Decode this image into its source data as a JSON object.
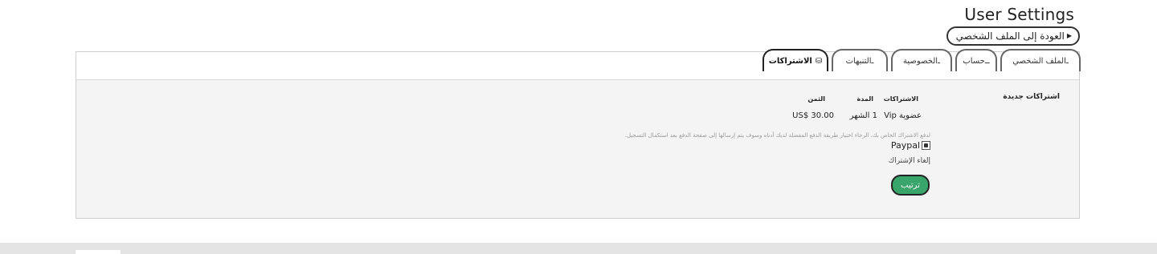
{
  "header": {
    "title": "User Settings",
    "back_label": "العودة إلى الملف الشخصي"
  },
  "tabs": [
    {
      "label": "الملف الشخصي",
      "prefix": "ـ"
    },
    {
      "label": "حساب",
      "prefix": "ــ"
    },
    {
      "label": "الخصوصية",
      "prefix": "ـ"
    },
    {
      "label": "التنبهات",
      "prefix": "ـ"
    },
    {
      "label": "الاشتراكات",
      "icon": "coins-icon",
      "active": true
    }
  ],
  "subscriptions": {
    "section_title": "اشتراكات جديدة",
    "columns": [
      "الاشتراكات",
      "المدة",
      "الثمن"
    ],
    "row": {
      "name": "عضوية Vip",
      "duration": "1 الشهر",
      "price": "US$ 30.00"
    },
    "payment_note": "لدفع الاشتراك الخاص بك، الرجاء اختيار طريقة الدفع المفضلة لديك أدناه وسوف يتم إرسالها إلى صفحة الدفع بعد استكمال التسجيل.",
    "payment_option": "Paypal",
    "payment_selected": true,
    "cancel_label": "إلغاء الإشتراك",
    "order_button": "ترتيب"
  },
  "colors": {
    "accent_button": "#3aa56b",
    "panel_background": "#f4f4f4",
    "footer_band": "#e4e4e4"
  }
}
